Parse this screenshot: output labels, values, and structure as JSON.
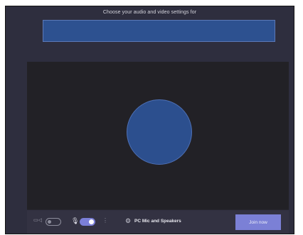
{
  "header": {
    "title": "Choose your audio and video settings for"
  },
  "title_field": {
    "value": ""
  },
  "toolbar": {
    "camera_icon": "camera-icon",
    "camera_toggle_on": false,
    "mic_icon": "microphone-icon",
    "mic_toggle_on": true,
    "audio_device_label": "PC Mic and Speakers",
    "join_label": "Join now"
  },
  "colors": {
    "window_bg": "#2e2e3e",
    "title_bar": "#2d5190",
    "preview_bg": "#222126",
    "avatar": "#2c4f8e",
    "accent": "#7b80d6"
  }
}
